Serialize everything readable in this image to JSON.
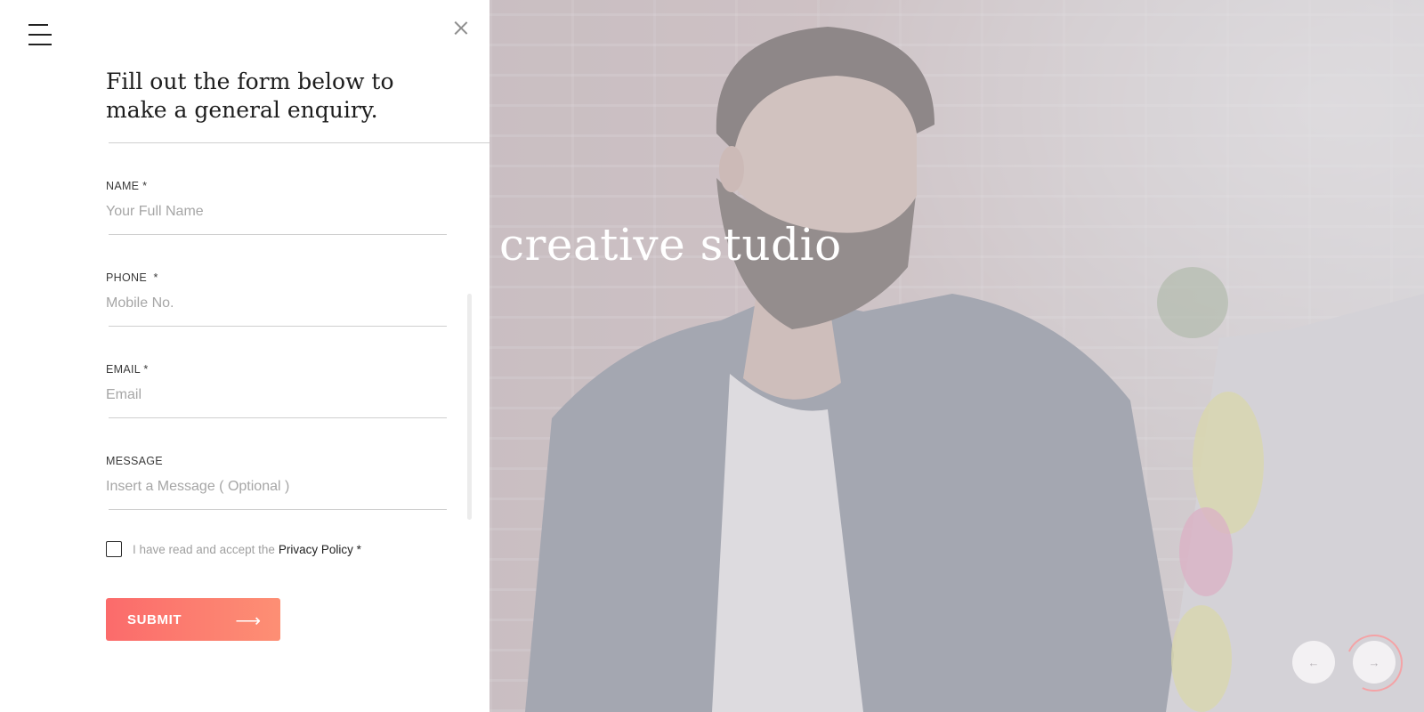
{
  "hero": {
    "title": "creative studio",
    "prev_label": "←",
    "next_label": "→"
  },
  "panel": {
    "heading": "Fill out the form below to make a general enquiry."
  },
  "form": {
    "name": {
      "label": "NAME *",
      "placeholder": "Your Full Name"
    },
    "phone": {
      "label": "PHONE  *",
      "placeholder": "Mobile No."
    },
    "email": {
      "label": "EMAIL *",
      "placeholder": "Email"
    },
    "message": {
      "label": "MESSAGE",
      "placeholder": "Insert a Message ( Optional )"
    },
    "consent_text": "I have read and accept the",
    "consent_link": "Privacy Policy *",
    "submit_label": "SUBMIT",
    "submit_arrow": "⟶"
  },
  "colors": {
    "accent_start": "#fb6b6b",
    "accent_end": "#fd8f74"
  }
}
